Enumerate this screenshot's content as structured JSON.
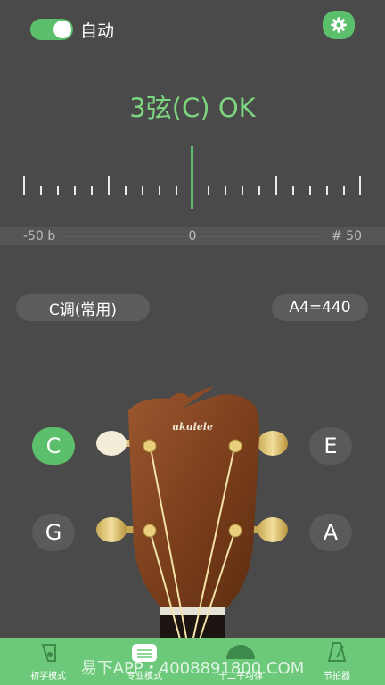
{
  "header": {
    "auto_label": "自动"
  },
  "status": {
    "text": "3弦(C) OK"
  },
  "scale": {
    "left": "-50 b",
    "center": "0",
    "right": "# 50"
  },
  "settings": {
    "key_label": "C调(常用)",
    "pitch_label": "A4=440"
  },
  "strings": {
    "c": "C",
    "g": "G",
    "e": "E",
    "a": "A",
    "active": "C"
  },
  "headstock": {
    "logo": "ukulele"
  },
  "nav": {
    "items": [
      {
        "label": "初学模式"
      },
      {
        "label": "专业模式"
      },
      {
        "label": "十二平均律"
      },
      {
        "label": "节拍器"
      }
    ]
  },
  "watermark": "易下APP・4008891800.COM",
  "colors": {
    "accent": "#5cbf6b",
    "status": "#7dd67f",
    "background": "#4a4a4a",
    "nav": "#6cc97a"
  }
}
